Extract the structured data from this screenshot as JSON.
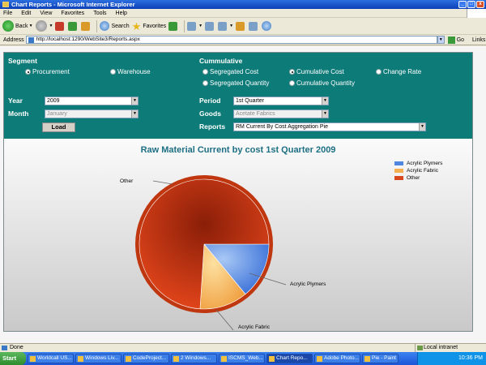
{
  "window": {
    "title": "Chart Reports - Microsoft Internet Explorer"
  },
  "menu": [
    "File",
    "Edit",
    "View",
    "Favorites",
    "Tools",
    "Help"
  ],
  "toolbar": {
    "back": "Back",
    "search": "Search",
    "favorites": "Favorites"
  },
  "address": {
    "label": "Address",
    "url": "http://localhost:1290/WebSite3/Reports.aspx",
    "go": "Go",
    "links": "Links"
  },
  "form": {
    "segment_label": "Segment",
    "segment_options": [
      "Procurement",
      "Warehouse"
    ],
    "cummulative_label": "Cummulative",
    "cummulative_options": [
      "Segregated Cost",
      "Cumulative Cost",
      "Change Rate",
      "Segregated Quantity",
      "Cumulative Quantity"
    ],
    "year_label": "Year",
    "year_value": "2009",
    "month_label": "Month",
    "month_value": "January",
    "load_label": "Load",
    "period_label": "Period",
    "period_value": "1st Quarter",
    "goods_label": "Goods",
    "goods_value": "Acetate Fabrics",
    "reports_label": "Reports",
    "reports_value": "RM Current By Cost Aggregation Pie"
  },
  "chart_data": {
    "type": "pie",
    "title": "Raw Material Current by cost 1st Quarter 2009",
    "slices": [
      {
        "name": "Acrylic Plymers",
        "value": 14,
        "color": "#4f86e0"
      },
      {
        "name": "Acrylic Fabric",
        "value": 12,
        "color": "#f4b050"
      },
      {
        "name": "Other",
        "value": 74,
        "color": "#d8481e"
      }
    ],
    "legend": "top-right"
  },
  "status": {
    "text": "Done",
    "zone": "Local intranet"
  },
  "taskbar": {
    "start": "Start",
    "tasks": [
      "Worldcall US...",
      "Windows Liv...",
      "CodeProject...",
      "2 Windows...",
      "ISCMS_Web...",
      "Chart Repo...",
      "Adobe Photo...",
      "Pie - Paint"
    ],
    "clock": "10:36 PM"
  }
}
